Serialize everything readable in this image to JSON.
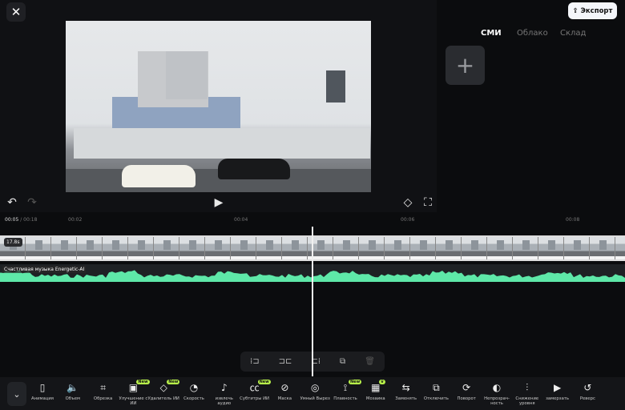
{
  "header": {
    "close_icon": "close-icon",
    "export_label": "Экспорт",
    "export_icon": "upload-icon"
  },
  "media_tabs": [
    {
      "label": "СМИ",
      "active": true
    },
    {
      "label": "Облако",
      "active": false
    },
    {
      "label": "Склад",
      "active": false
    }
  ],
  "add_media_icon": "plus-icon",
  "player": {
    "undo_icon": "undo-icon",
    "redo_icon": "redo-icon",
    "play_icon": "play-icon",
    "keyframe_icon": "keyframe-icon",
    "fullscreen_icon": "fullscreen-icon"
  },
  "timeline": {
    "current": "00:05",
    "total": " / 00:18",
    "ticks": [
      "00:02",
      "00:04",
      "00:06",
      "00:08"
    ],
    "clip_duration": "17.8s",
    "audio_label": "Счастливая музыка Energetic-AI",
    "waveform_color": "#5ee8a8"
  },
  "edit_bar": [
    {
      "icon": "split-left-icon"
    },
    {
      "icon": "split-icon"
    },
    {
      "icon": "split-right-icon"
    },
    {
      "icon": "duplicate-icon"
    },
    {
      "icon": "delete-icon"
    }
  ],
  "toolbar": {
    "collapse_icon": "chevron-down-icon",
    "tools": [
      {
        "label": "Анимация",
        "glyph": "▯"
      },
      {
        "label": "Объем",
        "glyph": "🔈"
      },
      {
        "label": "Обрезка",
        "glyph": "⌗"
      },
      {
        "label": "Улучшение с ИИ",
        "glyph": "▣",
        "badge": "New"
      },
      {
        "label": "Удалитель ИИ",
        "glyph": "◇",
        "badge": "New"
      },
      {
        "label": "Скорость",
        "glyph": "◔"
      },
      {
        "label": "извлечь аудио",
        "glyph": "♪"
      },
      {
        "label": "Субтитры ИИ",
        "glyph": "㏄",
        "badge": "New"
      },
      {
        "label": "Маска",
        "glyph": "⊘"
      },
      {
        "label": "Умный Вырез",
        "glyph": "◎"
      },
      {
        "label": "Плавность",
        "glyph": "⟟",
        "badge": "New"
      },
      {
        "label": "Мозаика",
        "glyph": "▦",
        "badge": "♛"
      },
      {
        "label": "Заменять",
        "glyph": "⇆"
      },
      {
        "label": "Отключить",
        "glyph": "⧉"
      },
      {
        "label": "Поворот",
        "glyph": "⟳"
      },
      {
        "label": "Непрозрач-ность",
        "glyph": "◐"
      },
      {
        "label": "Снижение уровня",
        "glyph": "⫶"
      },
      {
        "label": "замерзать",
        "glyph": "▶"
      },
      {
        "label": "Реверс",
        "glyph": "↺"
      }
    ]
  }
}
